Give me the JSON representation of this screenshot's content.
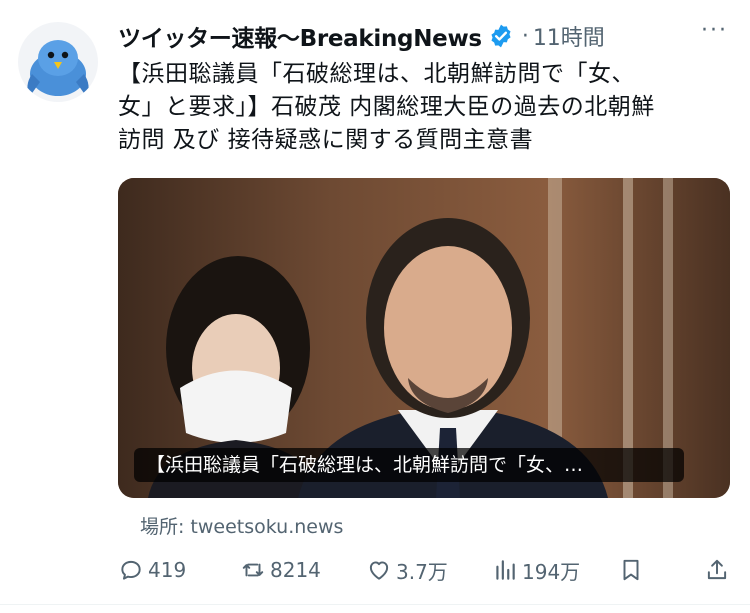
{
  "account": {
    "display_name": "ツイッター速報〜BreakingNews",
    "dot": "·",
    "time": "11時間",
    "more": "···"
  },
  "tweet": {
    "text": "【浜田聡議員「石破総理は、北朝鮮訪問で「女、\n女」と要求」】石破茂 内閣総理大臣の過去の北朝鮮\n訪問 及び 接待疑惑に関する質問主意書"
  },
  "media": {
    "caption": "【浜田聡議員「石破総理は、北朝鮮訪問で「女、…"
  },
  "source": {
    "label": "場所:",
    "domain": "tweetsoku.news"
  },
  "actions": {
    "replies": "419",
    "retweets": "8214",
    "likes": "3.7万",
    "views": "194万"
  },
  "colors": {
    "verified": "#1d9bf0",
    "secondary_text": "#536471",
    "text": "#0f1419"
  },
  "icons": [
    "avatar-bird-icon",
    "verified-icon",
    "more-icon",
    "reply-icon",
    "retweet-icon",
    "like-icon",
    "views-icon",
    "bookmark-icon",
    "share-icon"
  ]
}
